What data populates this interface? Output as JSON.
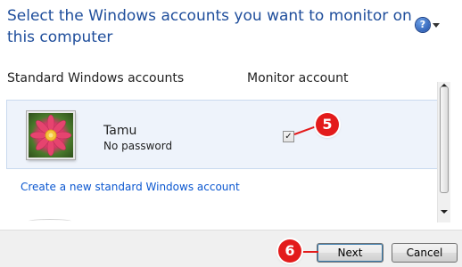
{
  "header": {
    "title": "Select the Windows accounts you want to monitor on this computer",
    "help_glyph": "?"
  },
  "columns": {
    "accounts": "Standard Windows accounts",
    "monitor": "Monitor account"
  },
  "accounts": [
    {
      "name": "Tamu",
      "status": "No password",
      "monitored": true
    }
  ],
  "checkbox_glyph": "✓",
  "links": {
    "create_account": "Create a new standard Windows account"
  },
  "buttons": {
    "next": "Next",
    "cancel": "Cancel"
  },
  "callouts": {
    "checkbox_step": "5",
    "next_step": "6"
  },
  "colors": {
    "title_blue": "#1e4d9b",
    "link_blue": "#0b57d0",
    "row_highlight": "#eef3fb",
    "callout_red": "#e31b1b"
  },
  "icons": [
    "help-icon",
    "chevron-down-icon",
    "user-flower-avatar",
    "checkbox-check-icon"
  ]
}
